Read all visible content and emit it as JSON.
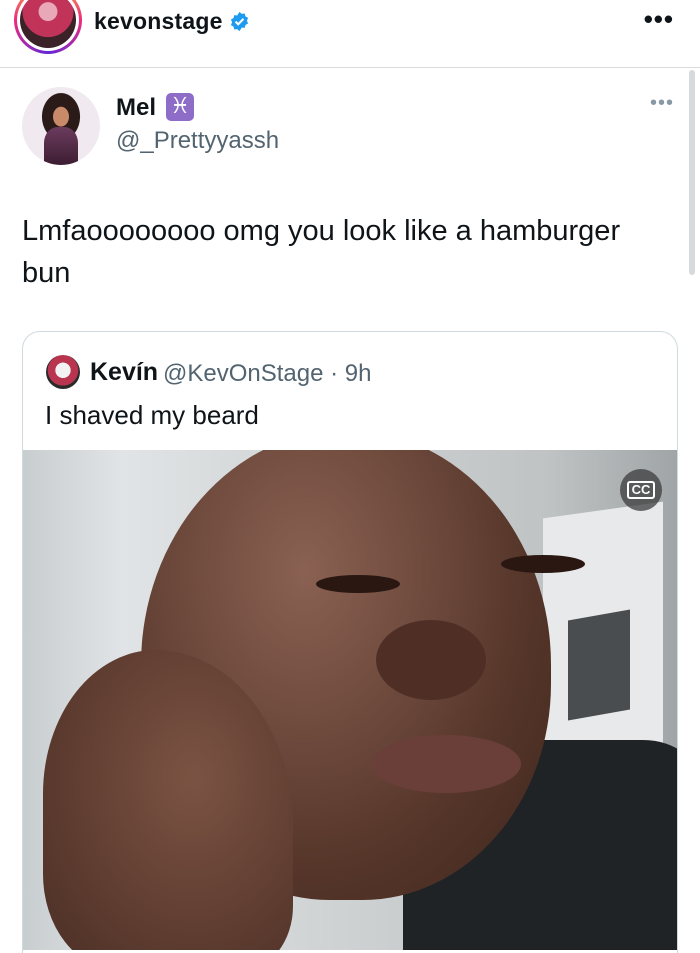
{
  "header": {
    "username": "kevonstage",
    "more_label": "•••"
  },
  "tweet": {
    "display_name": "Mel",
    "emoji": "♓",
    "handle": "@_Prettyyassh",
    "more_label": "•••",
    "text": "Lmfaoooooooo omg you look like a hamburger bun"
  },
  "quote": {
    "display_name": "Kevín",
    "handle_time": "@KevOnStage · 9h",
    "text": "I shaved my beard",
    "cc_label": "CC"
  },
  "colors": {
    "verified": "#1d9bf0",
    "handle": "#536471",
    "border": "#cfd9de",
    "pisces_bg": "#8e6dc8"
  }
}
